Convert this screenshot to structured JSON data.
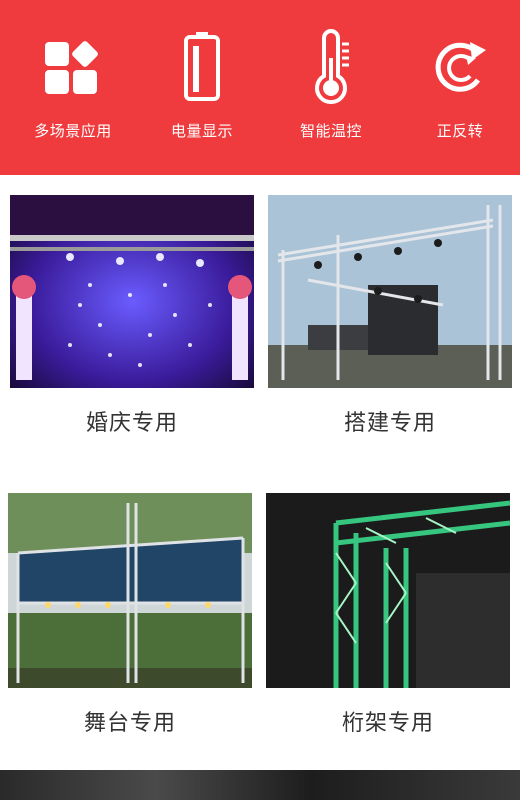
{
  "colors": {
    "banner": "#ef3b3e",
    "icon": "#ffffff",
    "caption": "#333333"
  },
  "features": [
    {
      "icon": "app-grid-icon",
      "label": "多场景应用"
    },
    {
      "icon": "battery-icon",
      "label": "电量显示"
    },
    {
      "icon": "thermometer-icon",
      "label": "智能温控"
    },
    {
      "icon": "rotate-icon",
      "label": "正反转"
    }
  ],
  "cards": [
    {
      "image": "wedding-stage-photo",
      "caption": "婚庆专用"
    },
    {
      "image": "outdoor-truss-photo",
      "caption": "搭建专用"
    },
    {
      "image": "stage-roof-photo",
      "caption": "舞台专用"
    },
    {
      "image": "truss-frame-photo",
      "caption": "桁架专用"
    }
  ]
}
